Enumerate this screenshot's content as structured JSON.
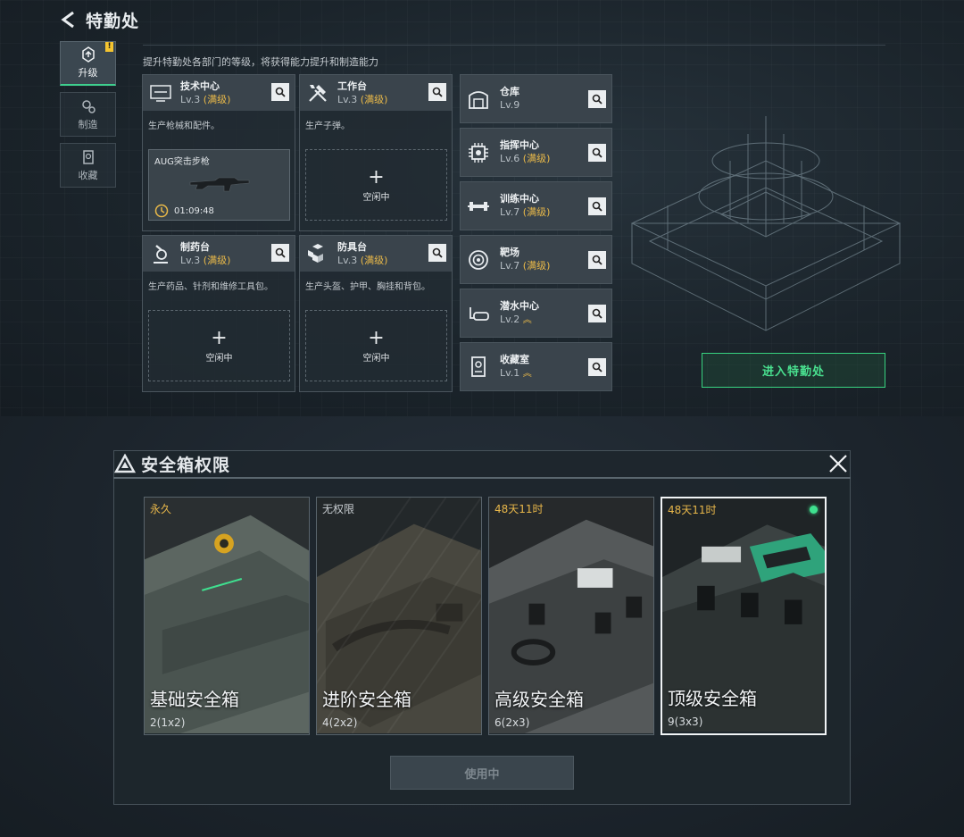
{
  "header": {
    "title": "特勤处",
    "description": "提升特勤处各部门的等级，将获得能力提升和制造能力"
  },
  "side_tabs": [
    {
      "label": "升级",
      "badge": "!"
    },
    {
      "label": "制造"
    },
    {
      "label": "收藏"
    }
  ],
  "facilities": [
    {
      "name": "技术中心",
      "level": "Lv.3",
      "status": "(满级)",
      "desc": "生产枪械和配件。",
      "slot": {
        "item": "AUG突击步枪",
        "timer": "01:09:48"
      }
    },
    {
      "name": "工作台",
      "level": "Lv.3",
      "status": "(满级)",
      "desc": "生产子弹。",
      "slot": {
        "plus": "+",
        "idle": "空闲中"
      }
    },
    {
      "name": "制药台",
      "level": "Lv.3",
      "status": "(满级)",
      "desc": "生产药品、针剂和维修工具包。",
      "slot": {
        "plus": "+",
        "idle": "空闲中"
      }
    },
    {
      "name": "防具台",
      "level": "Lv.3",
      "status": "(满级)",
      "desc": "生产头盔、护甲、胸挂和背包。",
      "slot": {
        "plus": "+",
        "idle": "空闲中"
      }
    }
  ],
  "side_facilities": [
    {
      "name": "仓库",
      "level": "Lv.9",
      "status": ""
    },
    {
      "name": "指挥中心",
      "level": "Lv.6",
      "status": "(满级)"
    },
    {
      "name": "训练中心",
      "level": "Lv.7",
      "status": "(满级)"
    },
    {
      "name": "靶场",
      "level": "Lv.7",
      "status": "(满级)"
    },
    {
      "name": "潜水中心",
      "level": "Lv.2",
      "status": ""
    },
    {
      "name": "收藏室",
      "level": "Lv.1",
      "status": ""
    }
  ],
  "enter_button": "进入特勤处",
  "modal": {
    "title": "安全箱权限",
    "boxes": [
      {
        "duration": "永久",
        "name": "基础安全箱",
        "size": "2(1x2)"
      },
      {
        "duration": "无权限",
        "name": "进阶安全箱",
        "size": "4(2x2)"
      },
      {
        "duration": "48天11时",
        "name": "高级安全箱",
        "size": "6(2x3)"
      },
      {
        "duration": "48天11时",
        "name": "顶级安全箱",
        "size": "9(3x3)"
      }
    ],
    "use_button": "使用中"
  },
  "colors": {
    "accent_green": "#3ecf8e",
    "max_level_gold": "#e9b949",
    "duration_gold": "#e8b74a"
  }
}
